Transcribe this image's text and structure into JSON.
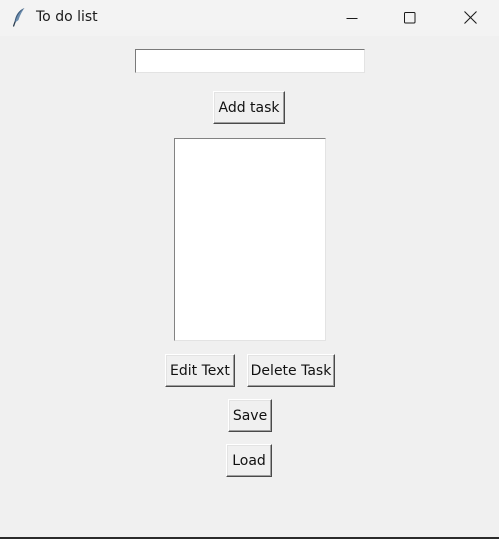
{
  "window": {
    "title": "To do list",
    "icon": "feather-icon",
    "controls": {
      "minimize": "minimize-icon",
      "maximize": "maximize-icon",
      "close": "close-icon"
    }
  },
  "task_entry": {
    "value": "",
    "placeholder": ""
  },
  "buttons": {
    "add_task": "Add task",
    "edit_text": "Edit Text",
    "delete_task": "Delete Task",
    "save": "Save",
    "load": "Load"
  },
  "task_list": {
    "items": []
  },
  "colors": {
    "background": "#f0f0f0",
    "titlebar": "#f3f3f3",
    "field": "#ffffff"
  }
}
